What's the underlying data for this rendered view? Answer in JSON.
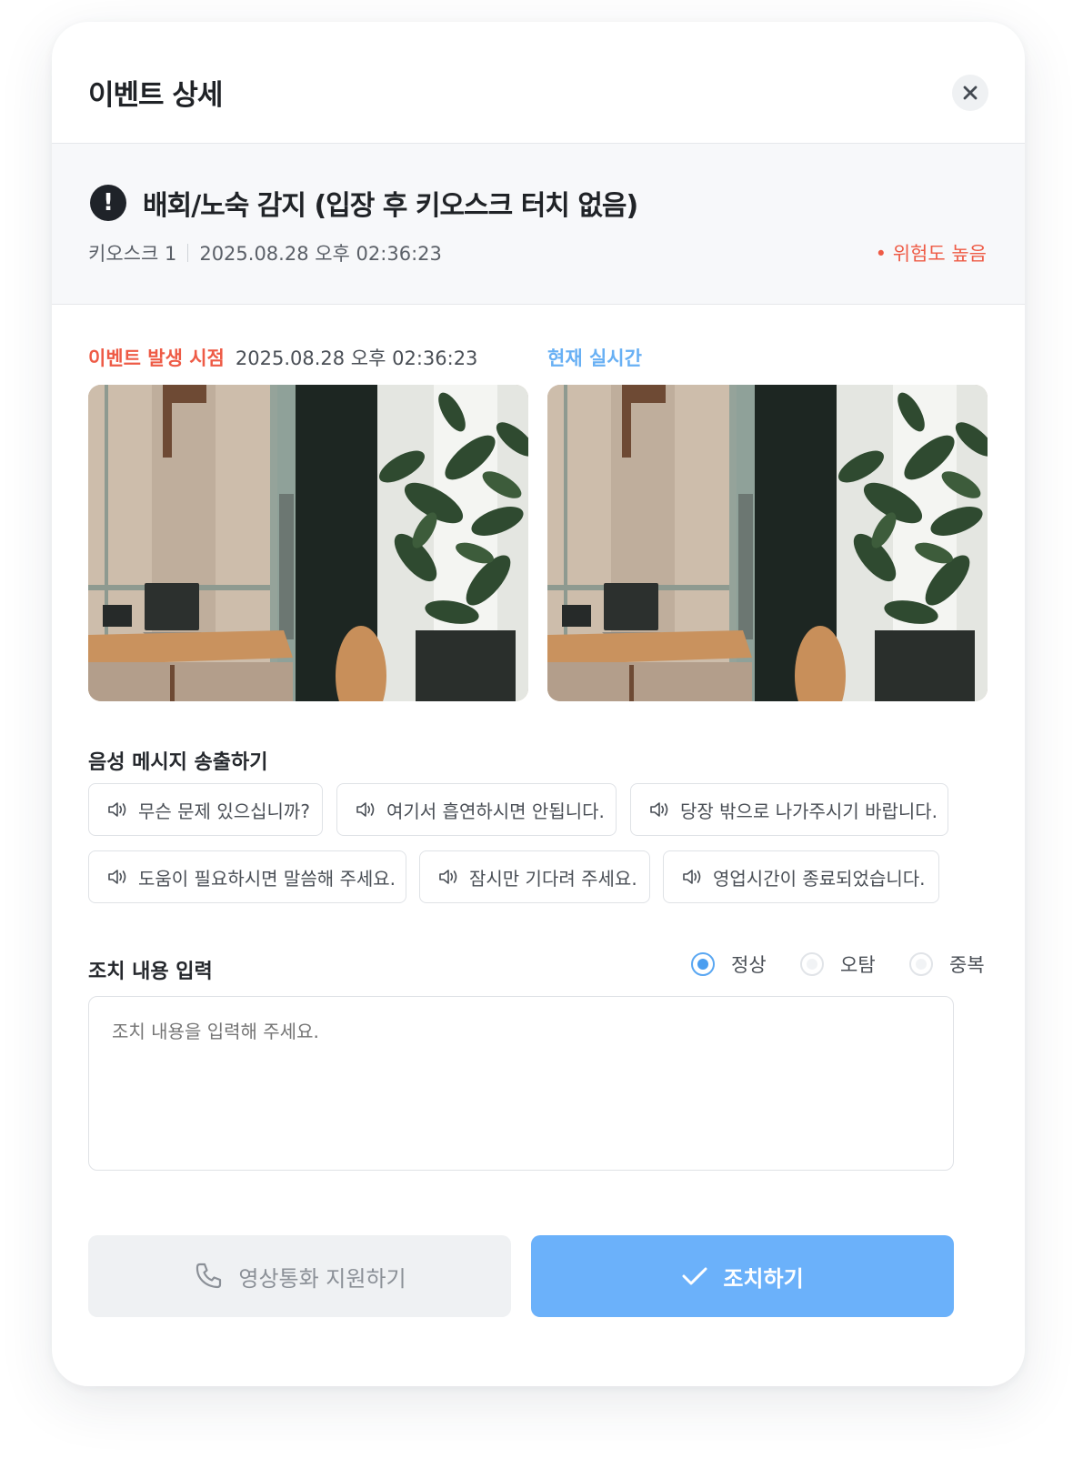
{
  "dialog": {
    "title": "이벤트 상세"
  },
  "event": {
    "title": "배회/노숙 감지 (입장 후 키오스크 터치 없음)",
    "device": "키오스크 1",
    "datetime": "2025.08.28 오후 02:36:23",
    "risk": "• 위험도 높음"
  },
  "captures": {
    "event_label": "이벤트 발생 시점",
    "event_time": "2025.08.28 오후 02:36:23",
    "live_label": "현재 실시간"
  },
  "voice": {
    "title": "음성 메시지 송출하기",
    "messages": [
      "무슨 문제 있으십니까?",
      "여기서 흡연하시면 안됩니다.",
      "당장 밖으로 나가주시기 바랍니다.",
      "도움이 필요하시면 말씀해 주세요.",
      "잠시만 기다려 주세요.",
      "영업시간이 종료되었습니다."
    ]
  },
  "action": {
    "title": "조치 내용 입력",
    "options": [
      "정상",
      "오탐",
      "중복"
    ],
    "selected": "정상",
    "placeholder": "조치 내용을 입력해 주세요."
  },
  "buttons": {
    "video_call": "영상통화 지원하기",
    "submit": "조치하기"
  },
  "colors": {
    "accent_blue": "#6bb1fa",
    "risk_red": "#ee5b46"
  }
}
